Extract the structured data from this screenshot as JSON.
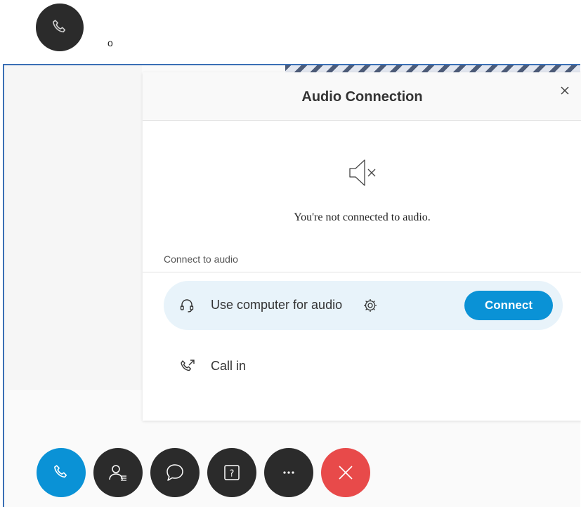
{
  "top": {
    "phone_icon": "phone-icon",
    "dot": "o"
  },
  "dialog": {
    "title": "Audio Connection",
    "close_icon": "close-icon",
    "status_icon": "speaker-muted-icon",
    "status_text": "You're not connected to audio.",
    "section_label": "Connect to audio",
    "options": [
      {
        "icon": "headset-icon",
        "label": "Use computer for audio",
        "settings_icon": "gear-icon",
        "button": "Connect"
      },
      {
        "icon": "phone-outgoing-icon",
        "label": "Call in"
      }
    ]
  },
  "toolbar": {
    "buttons": [
      {
        "icon": "phone-icon",
        "color": "#0a92d6"
      },
      {
        "icon": "participants-icon",
        "color": "#2b2b2b"
      },
      {
        "icon": "chat-icon",
        "color": "#2b2b2b"
      },
      {
        "icon": "help-icon",
        "color": "#2b2b2b",
        "label": "?"
      },
      {
        "icon": "more-icon",
        "color": "#2b2b2b",
        "label": "···"
      },
      {
        "icon": "end-call-icon",
        "color": "#e84a4a"
      }
    ]
  },
  "colors": {
    "accent": "#0a92d6",
    "danger": "#e84a4a",
    "dark": "#2b2b2b",
    "frame": "#3a6fb5"
  }
}
